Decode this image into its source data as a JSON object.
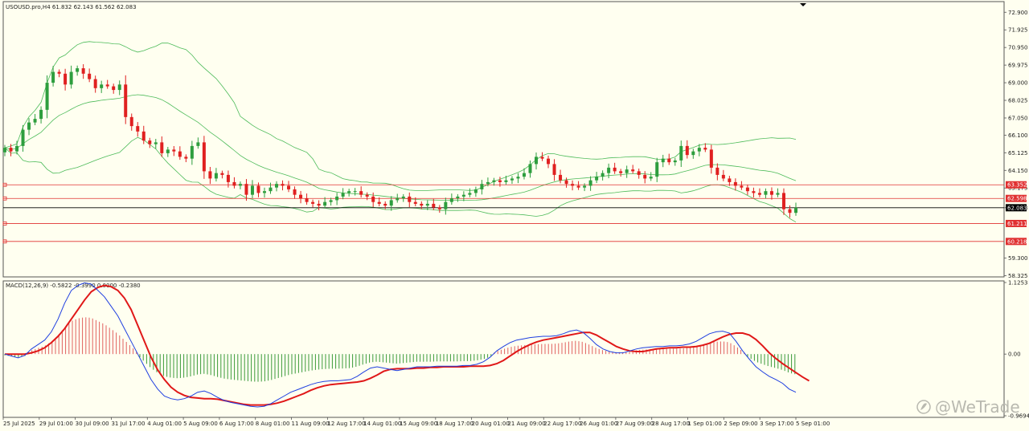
{
  "header": {
    "symbol_info": "USOUSD.pro,H4  61.832 62.143 61.562 62.083",
    "macd_info": "MACD(12,26,9) -0.5822 -0.3990 0.0000 -0.2380"
  },
  "watermark": {
    "text": "@WeTrade",
    "icon": "wetrade-logo-icon"
  },
  "colors": {
    "background": "#fffff0",
    "bull": "#2e9e3e",
    "bear": "#e02020",
    "bands": "#4dbb5a",
    "hline": "#e03030",
    "macd_line": "#1f3fe0",
    "signal_line": "#e01818",
    "hist_pos": "#e06060",
    "hist_neg": "#3a9a3a"
  },
  "price_axis": [
    "72.900",
    "71.925",
    "70.950",
    "69.975",
    "69.000",
    "68.025",
    "67.050",
    "66.100",
    "65.125",
    "64.150",
    "63.175",
    "62.083",
    "59.300",
    "58.325"
  ],
  "macd_axis": [
    "1.1253",
    "0.00",
    "-0.9694"
  ],
  "price_tags": [
    {
      "label": "63.352",
      "price": 63.352,
      "bg": "#e03030"
    },
    {
      "label": "62.598",
      "price": 62.598,
      "bg": "#e03030"
    },
    {
      "label": "62.083",
      "price": 62.083,
      "bg": "#000000"
    },
    {
      "label": "61.211",
      "price": 61.211,
      "bg": "#e03030"
    },
    {
      "label": "60.218",
      "price": 60.218,
      "bg": "#e03030"
    }
  ],
  "time_axis": [
    "25 Jul 2025",
    "29 Jul 01:00",
    "30 Jul 09:00",
    "31 Jul 17:00",
    "4 Aug 01:00",
    "5 Aug 09:00",
    "6 Aug 17:00",
    "8 Aug 01:00",
    "11 Aug 09:00",
    "12 Aug 17:00",
    "14 Aug 01:00",
    "15 Aug 09:00",
    "18 Aug 17:00",
    "20 Aug 01:00",
    "21 Aug 09:00",
    "22 Aug 17:00",
    "26 Aug 01:00",
    "27 Aug 09:00",
    "28 Aug 17:00",
    "1 Sep 01:00",
    "2 Sep 09:00",
    "3 Sep 17:00",
    "5 Sep 01:00"
  ],
  "chart_data": [
    {
      "type": "candlestick",
      "title": "USOUSD.pro,H4",
      "timeframe": "H4",
      "ohlc_last": {
        "open": 61.832,
        "high": 62.143,
        "low": 61.562,
        "close": 62.083
      },
      "ylim": [
        58.3,
        73.4
      ],
      "horizontal_lines": [
        63.352,
        62.598,
        62.083,
        61.211,
        60.218
      ],
      "closes": [
        65.4,
        65.2,
        65.5,
        66.4,
        66.8,
        67.0,
        67.5,
        69.0,
        69.6,
        69.5,
        68.9,
        69.6,
        69.8,
        69.5,
        69.2,
        68.7,
        68.9,
        68.8,
        68.6,
        68.9,
        67.1,
        66.6,
        66.3,
        65.8,
        65.6,
        65.7,
        65.1,
        65.3,
        65.2,
        64.9,
        64.8,
        65.5,
        65.7,
        64.1,
        63.7,
        64.0,
        63.9,
        63.5,
        63.3,
        63.4,
        62.8,
        63.3,
        62.9,
        63.0,
        63.2,
        63.4,
        63.3,
        63.1,
        62.8,
        62.6,
        62.4,
        62.3,
        62.2,
        62.4,
        62.5,
        62.7,
        62.9,
        63.0,
        63.0,
        62.8,
        62.7,
        62.4,
        62.3,
        62.2,
        62.5,
        62.6,
        62.7,
        62.4,
        62.3,
        62.2,
        62.3,
        62.1,
        62.0,
        62.4,
        62.6,
        62.7,
        62.8,
        62.9,
        63.1,
        63.4,
        63.5,
        63.6,
        63.5,
        63.6,
        63.7,
        63.8,
        64.0,
        64.5,
        64.9,
        64.8,
        64.5,
        63.9,
        63.6,
        63.4,
        63.3,
        63.2,
        63.3,
        63.6,
        63.8,
        64.0,
        64.3,
        64.1,
        64.0,
        64.2,
        64.1,
        63.9,
        63.7,
        63.8,
        64.6,
        64.8,
        64.6,
        64.7,
        65.5,
        65.0,
        65.2,
        65.4,
        65.3,
        64.3,
        63.9,
        63.7,
        63.5,
        63.3,
        63.2,
        63.0,
        62.9,
        62.8,
        63.0,
        62.8,
        62.9,
        62.0,
        61.8,
        62.083
      ],
      "macd_line_values": [
        0.0,
        -0.03,
        -0.06,
        -0.02,
        0.08,
        0.15,
        0.22,
        0.35,
        0.55,
        0.8,
        1.0,
        1.08,
        1.12,
        1.1,
        1.0,
        0.9,
        0.75,
        0.6,
        0.4,
        0.2,
        0.0,
        -0.2,
        -0.4,
        -0.55,
        -0.66,
        -0.7,
        -0.72,
        -0.7,
        -0.66,
        -0.6,
        -0.58,
        -0.62,
        -0.68,
        -0.73,
        -0.76,
        -0.78,
        -0.8,
        -0.82,
        -0.83,
        -0.82,
        -0.78,
        -0.72,
        -0.66,
        -0.6,
        -0.56,
        -0.52,
        -0.48,
        -0.45,
        -0.43,
        -0.42,
        -0.42,
        -0.41,
        -0.4,
        -0.35,
        -0.28,
        -0.22,
        -0.2,
        -0.22,
        -0.24,
        -0.26,
        -0.24,
        -0.22,
        -0.2,
        -0.2,
        -0.2,
        -0.19,
        -0.19,
        -0.19,
        -0.19,
        -0.18,
        -0.18,
        -0.16,
        -0.12,
        -0.05,
        0.05,
        0.12,
        0.18,
        0.22,
        0.24,
        0.26,
        0.27,
        0.28,
        0.28,
        0.29,
        0.32,
        0.36,
        0.38,
        0.34,
        0.25,
        0.15,
        0.08,
        0.04,
        0.02,
        0.02,
        0.05,
        0.08,
        0.1,
        0.11,
        0.12,
        0.12,
        0.13,
        0.13,
        0.14,
        0.16,
        0.2,
        0.26,
        0.32,
        0.35,
        0.36,
        0.33,
        0.2,
        0.05,
        -0.08,
        -0.2,
        -0.28,
        -0.35,
        -0.4,
        -0.46,
        -0.55,
        -0.6
      ],
      "signal_line_values": [
        0.0,
        0.0,
        0.0,
        0.0,
        0.02,
        0.05,
        0.1,
        0.18,
        0.28,
        0.4,
        0.55,
        0.7,
        0.85,
        0.98,
        1.05,
        1.08,
        1.06,
        1.0,
        0.88,
        0.7,
        0.45,
        0.2,
        -0.05,
        -0.25,
        -0.4,
        -0.52,
        -0.6,
        -0.65,
        -0.68,
        -0.69,
        -0.7,
        -0.7,
        -0.71,
        -0.73,
        -0.75,
        -0.77,
        -0.79,
        -0.8,
        -0.8,
        -0.8,
        -0.79,
        -0.77,
        -0.74,
        -0.7,
        -0.66,
        -0.62,
        -0.57,
        -0.53,
        -0.5,
        -0.48,
        -0.47,
        -0.46,
        -0.45,
        -0.44,
        -0.42,
        -0.38,
        -0.33,
        -0.27,
        -0.24,
        -0.23,
        -0.23,
        -0.23,
        -0.22,
        -0.22,
        -0.21,
        -0.21,
        -0.2,
        -0.2,
        -0.2,
        -0.2,
        -0.19,
        -0.19,
        -0.19,
        -0.18,
        -0.15,
        -0.1,
        -0.03,
        0.04,
        0.1,
        0.15,
        0.19,
        0.22,
        0.24,
        0.26,
        0.28,
        0.3,
        0.32,
        0.34,
        0.34,
        0.3,
        0.24,
        0.18,
        0.12,
        0.08,
        0.05,
        0.04,
        0.04,
        0.06,
        0.08,
        0.09,
        0.1,
        0.1,
        0.11,
        0.11,
        0.12,
        0.14,
        0.17,
        0.22,
        0.27,
        0.31,
        0.33,
        0.33,
        0.3,
        0.23,
        0.13,
        0.02,
        -0.07,
        -0.15,
        -0.22,
        -0.29,
        -0.36,
        -0.42
      ]
    }
  ]
}
